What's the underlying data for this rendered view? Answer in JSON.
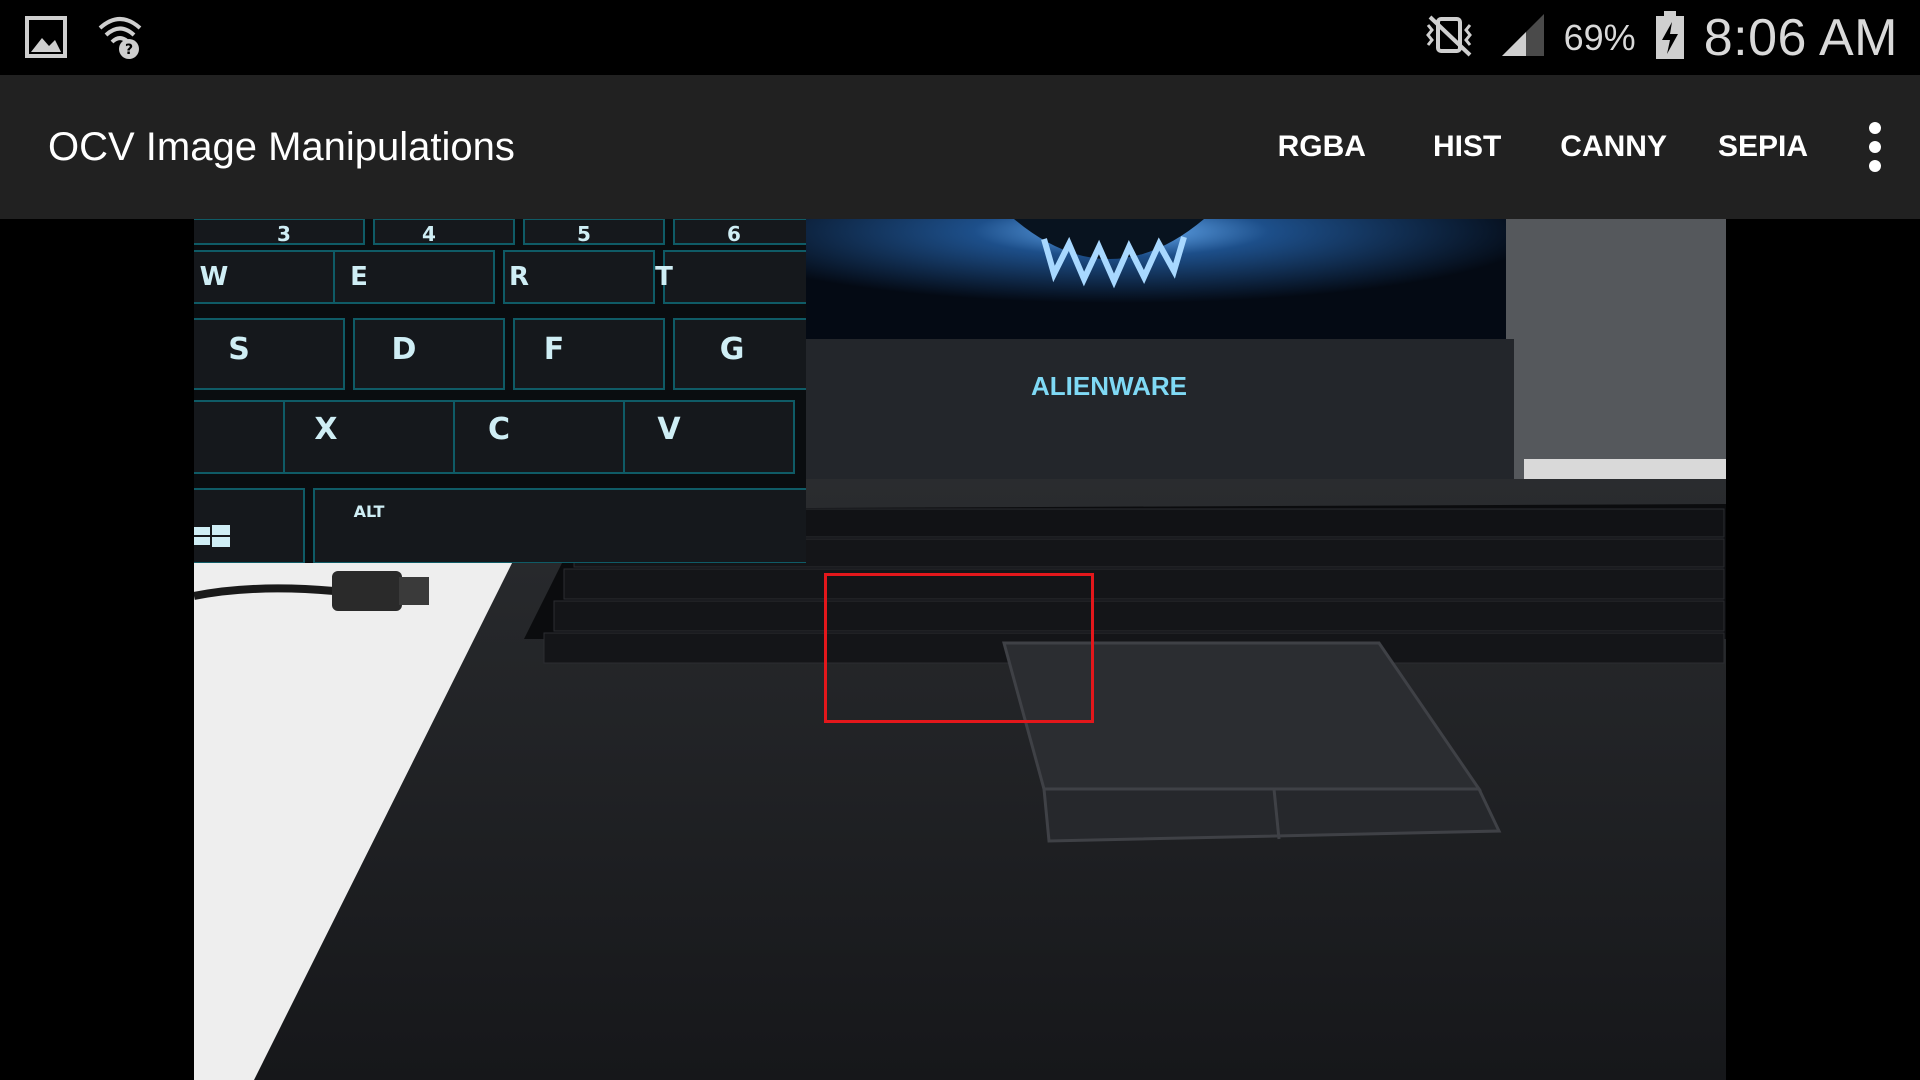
{
  "status_bar": {
    "battery_percent": "69%",
    "time": "8:06 AM",
    "icons": [
      "gallery-icon",
      "wifi-unknown-icon",
      "vibrate-mute-icon",
      "signal-icon",
      "battery-charging-icon"
    ]
  },
  "action_bar": {
    "title": "OCV Image Manipulations",
    "actions": [
      "RGBA",
      "HIST",
      "CANNY",
      "SEPIA"
    ],
    "overflow_icon": "more-vert-icon"
  },
  "camera": {
    "laptop_brand_text": "ALIENWARE",
    "zoom_keys_row1": [
      "3",
      "4",
      "5",
      "6"
    ],
    "zoom_keys_row2": [
      "W",
      "E",
      "R",
      "T"
    ],
    "zoom_keys_row3": [
      "S",
      "D",
      "F",
      "G"
    ],
    "zoom_keys_row4": [
      "X",
      "C",
      "V"
    ],
    "zoom_keys_row5": [
      "ALT"
    ],
    "selection_color": "#e3171b"
  }
}
